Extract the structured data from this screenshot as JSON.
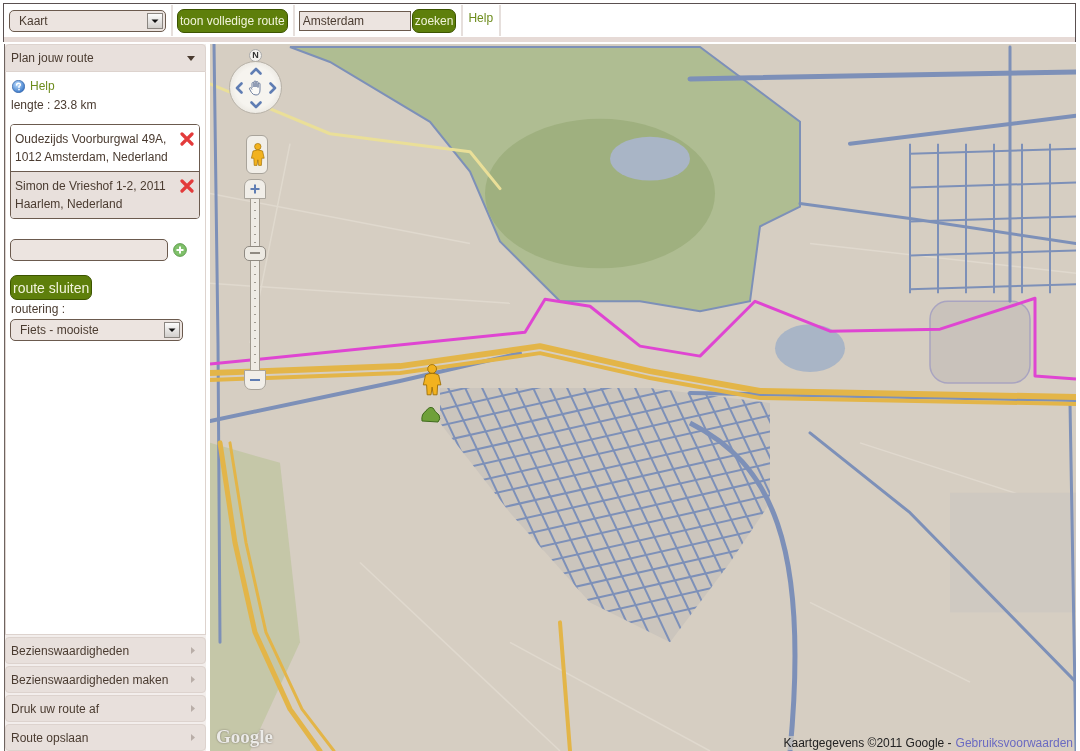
{
  "toolbar": {
    "map_type": {
      "value": "Kaart"
    },
    "show_route_button": "toon volledige route",
    "search": {
      "value": "Amsterdam"
    },
    "search_button": "zoeken",
    "help_link": "Help"
  },
  "sidebar": {
    "sections": [
      {
        "title": "Plan jouw route",
        "expanded": true,
        "panel": {
          "help_link": "Help",
          "length": "lengte : 23.8 km",
          "waypoints": [
            {
              "address": "Oudezijds Voorburgwal 49A, 1012 Amsterdam, Nederland",
              "selected": false
            },
            {
              "address": "Simon de Vrieshof 1-2, 2011 Haarlem, Nederland",
              "selected": true
            }
          ],
          "close_button": "route sluiten",
          "routing_label": "routering :",
          "routing": {
            "value": "Fiets - mooiste"
          }
        }
      },
      {
        "title": "Bezienswaardigheden",
        "expanded": false
      },
      {
        "title": "Bezienswaardigheden maken",
        "expanded": false
      },
      {
        "title": "Druk uw route af",
        "expanded": false
      },
      {
        "title": "Route opslaan",
        "expanded": false
      }
    ]
  },
  "map": {
    "compass": "N",
    "zoom": {
      "level": 0.7
    },
    "logo": "Google",
    "attribution": "Kaartgegevens ©2011 Google -",
    "terms_link": "Gebruiksvoorwaarden"
  }
}
